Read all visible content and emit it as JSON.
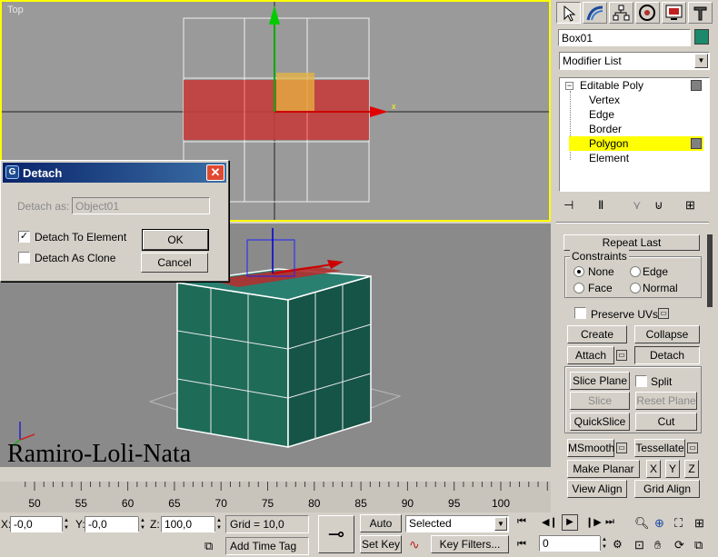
{
  "viewports": {
    "top_label": "Top",
    "axis_x": "x",
    "watermark": "Ramiro-Loli-Nata"
  },
  "dialog": {
    "title": "Detach",
    "detach_as_label": "Detach as:",
    "detach_as_value": "Object01",
    "to_element_label": "Detach To Element",
    "to_element_checked": true,
    "as_clone_label": "Detach As Clone",
    "as_clone_checked": false,
    "ok_label": "OK",
    "cancel_label": "Cancel"
  },
  "command_panel": {
    "tabs": [
      "create-icon",
      "modify-icon",
      "hierarchy-icon",
      "motion-icon",
      "display-icon",
      "utilities-icon"
    ],
    "object_name": "Box01",
    "object_color": "#1a8a6a",
    "modifier_list": "Modifier List",
    "stack_root": "Editable Poly",
    "stack_items": [
      "Vertex",
      "Edge",
      "Border",
      "Polygon",
      "Element"
    ],
    "stack_selected": "Polygon",
    "highlight_color": "#ffff00",
    "repeat_last": "Repeat Last",
    "constraints_label": "Constraints",
    "constraints": [
      "None",
      "Edge",
      "Face",
      "Normal"
    ],
    "constraint_selected": "None",
    "preserve_uvs": "Preserve UVs",
    "create": "Create",
    "collapse": "Collapse",
    "attach": "Attach",
    "detach": "Detach",
    "slice_plane": "Slice Plane",
    "split": "Split",
    "slice": "Slice",
    "reset_plane": "Reset Plane",
    "quickslice": "QuickSlice",
    "cut": "Cut",
    "msmooth": "MSmooth",
    "tessellate": "Tessellate",
    "make_planar": "Make Planar",
    "axis_x": "X",
    "axis_y": "Y",
    "axis_z": "Z",
    "view_align": "View Align",
    "grid_align": "Grid Align"
  },
  "timeline": {
    "ticks": [
      "50",
      "55",
      "60",
      "65",
      "70",
      "75",
      "80",
      "85",
      "90",
      "95",
      "100"
    ]
  },
  "status": {
    "x_label": "X:",
    "x_value": "-0,0",
    "y_label": "Y:",
    "y_value": "-0,0",
    "z_label": "Z:",
    "z_value": "100,0",
    "grid": "Grid = 10,0",
    "add_time_tag": "Add Time Tag",
    "auto_key": "Auto Key",
    "selected": "Selected",
    "set_key": "Set Key",
    "key_filters": "Key Filters...",
    "frame": "0"
  }
}
